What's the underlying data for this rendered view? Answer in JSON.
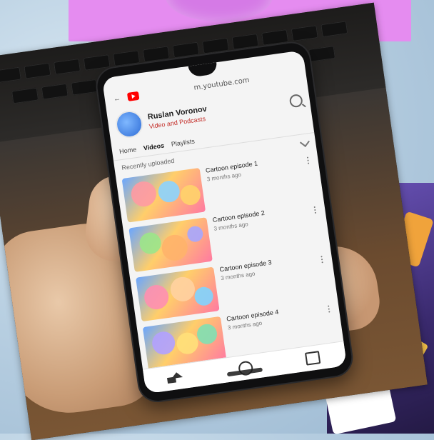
{
  "phone": {
    "url": "m.youtube.com",
    "channel": {
      "name": "Ruslan Voronov",
      "subtitle": "Video and Podcasts"
    },
    "tabs": [
      {
        "label": "Home",
        "active": false
      },
      {
        "label": "Videos",
        "active": true
      },
      {
        "label": "Playlists",
        "active": false
      }
    ],
    "filter_label": "Recently uploaded",
    "videos": [
      {
        "title": "Cartoon episode 1",
        "sub": "3 months ago"
      },
      {
        "title": "Cartoon episode 2",
        "sub": "3 months ago"
      },
      {
        "title": "Cartoon episode 3",
        "sub": "3 months ago"
      },
      {
        "title": "Cartoon episode 4",
        "sub": "3 months ago"
      }
    ]
  },
  "colors": {
    "banner": "#e58cf0",
    "youtube_red": "#ff0000",
    "poster_purple": "#6a53b8"
  }
}
